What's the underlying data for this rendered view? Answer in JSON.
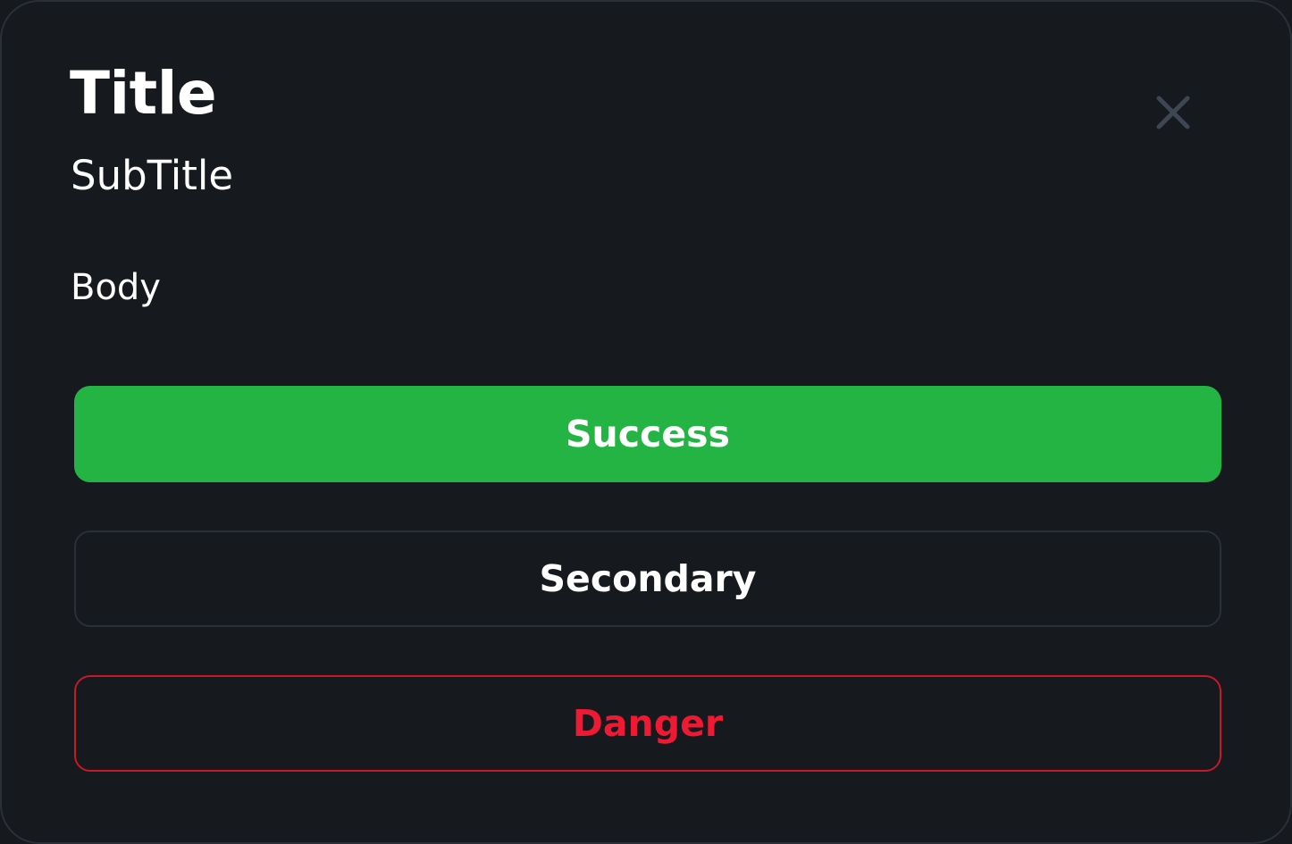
{
  "dialog": {
    "title": "Title",
    "subtitle": "SubTitle",
    "body": "Body",
    "close_icon": "close-icon"
  },
  "buttons": {
    "success_label": "Success",
    "secondary_label": "Secondary",
    "danger_label": "Danger"
  },
  "colors": {
    "background": "#16191d",
    "success": "#24b444",
    "danger": "#ee1a33",
    "secondary_border": "#2a2f38",
    "close_icon": "#3d4652"
  }
}
